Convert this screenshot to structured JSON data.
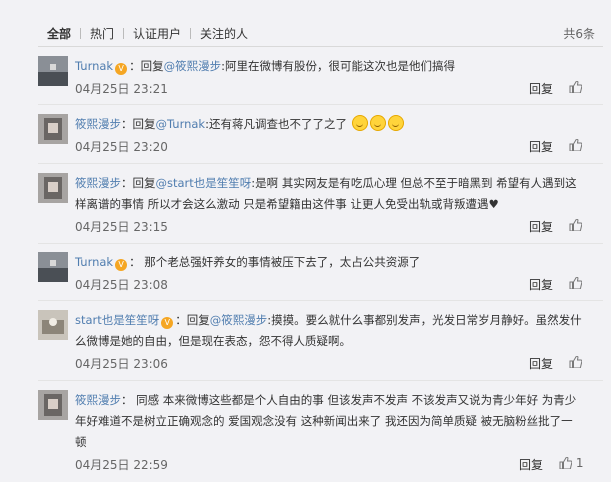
{
  "tabs": [
    "全部",
    "热门",
    "认证用户",
    "关注的人"
  ],
  "total": "共6条",
  "reply_label": "回复",
  "comments": [
    {
      "user": "Turnak",
      "prefix": "回复",
      "at": "@筱熙漫步",
      "text": ":阿里在微博有股份，很可能这次也是他们搞得",
      "time": "04月25日 23:21",
      "likes": ""
    },
    {
      "user": "筱熙漫步",
      "prefix": "回复",
      "at": "@Turnak",
      "text": ":还有蒋凡调查也不了了之了",
      "time": "04月25日 23:20",
      "likes": ""
    },
    {
      "user": "筱熙漫步",
      "prefix": "回复",
      "at": "@start也是笙笙呀",
      "text": ":是啊 其实网友是有吃瓜心理 但总不至于暗黑到 希望有人遇到这样离谱的事情 所以才会这么激动 只是希望籍由这件事 让更人免受出轨或背叛遭遇",
      "time": "04月25日 23:15",
      "likes": ""
    },
    {
      "user": "Turnak",
      "prefix": "",
      "at": "",
      "text": "那个老总强奸养女的事情被压下去了，太占公共资源了",
      "time": "04月25日 23:08",
      "likes": ""
    },
    {
      "user": "start也是笙笙呀",
      "prefix": "回复",
      "at": "@筱熙漫步",
      "text": ":摸摸。要么就什么事都别发声，光发日常岁月静好。虽然发什么微博是她的自由，但是现在表态，怨不得人质疑啊。",
      "time": "04月25日 23:06",
      "likes": ""
    },
    {
      "user": "筱熙漫步",
      "prefix": "",
      "at": "",
      "text": "同感 本来微博这些都是个人自由的事 但该发声不发声 不该发声又说为青少年好 为青少年好难道不是树立正确观念的 爱国观念没有 这种新闻出来了 我还因为简单质疑 被无脑粉丝批了一顿",
      "time": "04月25日 22:59",
      "likes": "1"
    }
  ],
  "icons": {
    "vip": "vip-badge-icon",
    "like": "thumb-up-icon",
    "emoji": "laugh-emoji-icon"
  }
}
